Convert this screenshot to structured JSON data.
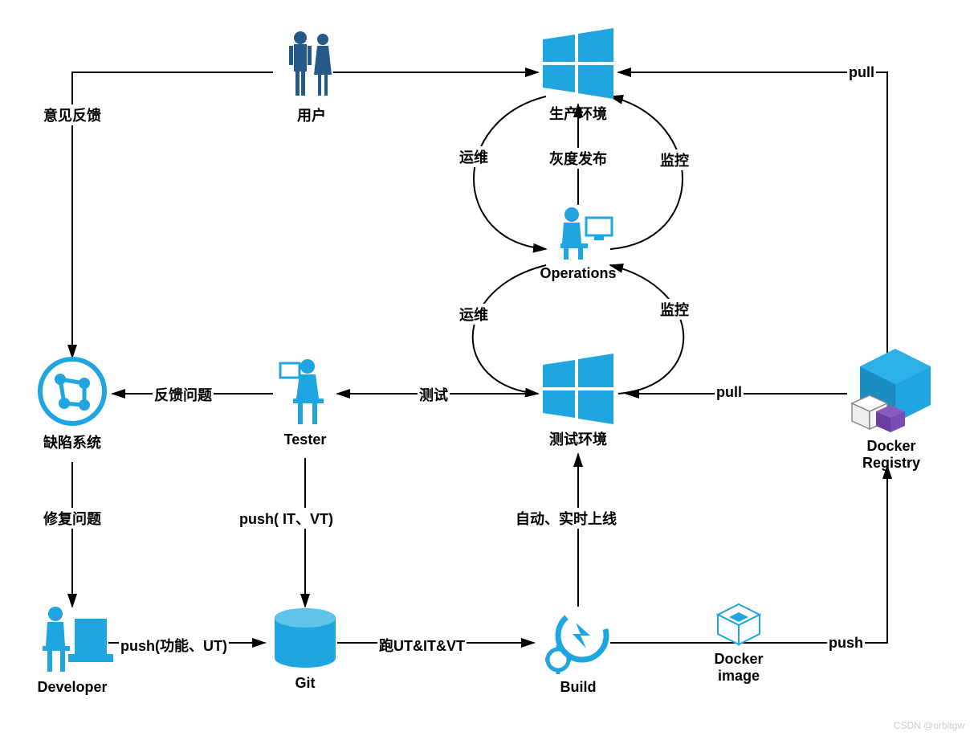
{
  "nodes": {
    "users": {
      "label": "用户"
    },
    "prod": {
      "label": "生产环境"
    },
    "ops": {
      "label": "Operations"
    },
    "testenv": {
      "label": "测试环境"
    },
    "tester": {
      "label": "Tester"
    },
    "defect": {
      "label": "缺陷系统"
    },
    "developer": {
      "label": "Developer"
    },
    "git": {
      "label": "Git"
    },
    "build": {
      "label": "Build"
    },
    "dockerimg": {
      "label": "Docker\nimage"
    },
    "registry": {
      "label": "Docker\nRegistry"
    }
  },
  "edges": {
    "feedback": {
      "label": "意见反馈"
    },
    "opsL": {
      "label": "运维"
    },
    "opsR": {
      "label": "监控"
    },
    "gray": {
      "label": "灰度发布"
    },
    "opsL2": {
      "label": "运维"
    },
    "opsR2": {
      "label": "监控"
    },
    "test": {
      "label": "测试"
    },
    "fbIssue": {
      "label": "反馈问题"
    },
    "fix": {
      "label": "修复问题"
    },
    "pushItVt": {
      "label": "push( IT、VT)"
    },
    "pushUt": {
      "label": "push(功能、UT)"
    },
    "runTests": {
      "label": "跑UT&IT&VT"
    },
    "autoOnline": {
      "label": "自动、实时上线"
    },
    "push": {
      "label": "push"
    },
    "pullTest": {
      "label": "pull"
    },
    "pullProd": {
      "label": "pull"
    }
  },
  "watermark": "CSDN @orbitgw",
  "colors": {
    "accent": "#1fa5e0",
    "suit": "#255a88",
    "purple": "#6b3fa0"
  }
}
